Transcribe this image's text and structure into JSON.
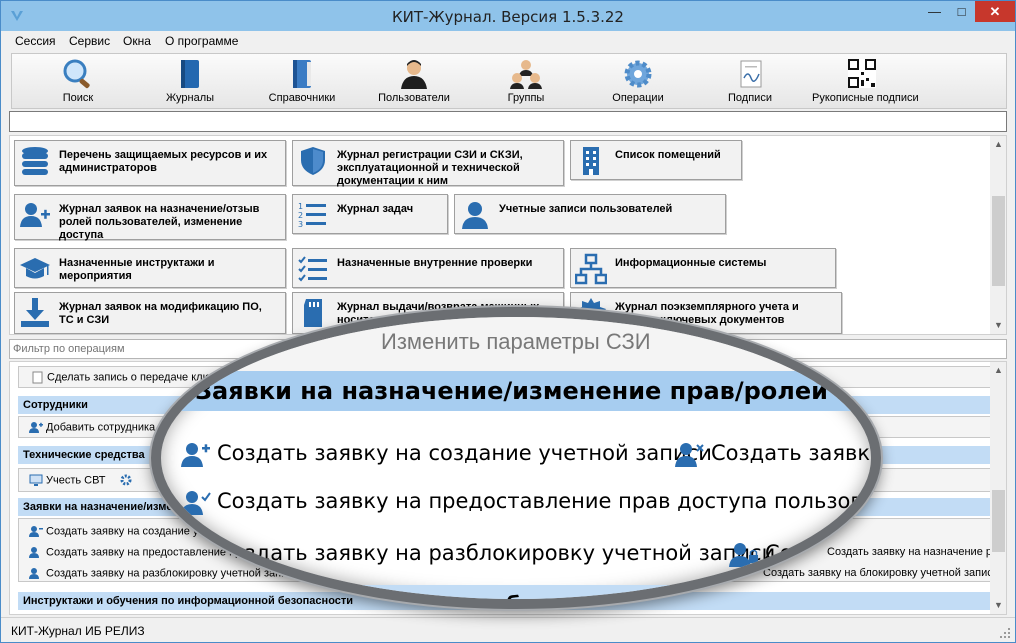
{
  "window": {
    "title": "КИТ-Журнал. Версия 1.5.3.22",
    "buttons": {
      "minimize": "—",
      "maximize": "□",
      "close": "✕"
    }
  },
  "menu": [
    "Сессия",
    "Сервис",
    "Окна",
    "О программе"
  ],
  "toolbar": [
    {
      "label": "Поиск",
      "icon": "magnifier-icon"
    },
    {
      "label": "Журналы",
      "icon": "book-icon"
    },
    {
      "label": "Справочники",
      "icon": "reference-book-icon"
    },
    {
      "label": "Пользователи",
      "icon": "user-icon"
    },
    {
      "label": "Группы",
      "icon": "group-icon"
    },
    {
      "label": "Операции",
      "icon": "gear-icon"
    },
    {
      "label": "Подписи",
      "icon": "signature-icon"
    },
    {
      "label": "Рукописные подписи",
      "icon": "qr-code-icon"
    }
  ],
  "search": {
    "value": ""
  },
  "tiles": [
    {
      "label": "Перечень защищаемых ресурсов и их администраторов",
      "icon": "database-icon"
    },
    {
      "label": "Журнал регистрации СЗИ и СКЗИ, эксплуатационной и технической документации к ним",
      "icon": "shield-icon"
    },
    {
      "label": "Список помещений",
      "icon": "building-icon"
    },
    {
      "label": "Журнал заявок на назначение/отзыв ролей пользователей, изменение доступа",
      "icon": "user-add-icon"
    },
    {
      "label": "Журнал задач",
      "icon": "numbered-list-icon"
    },
    {
      "label": "Учетные записи пользователей",
      "icon": "user-circle-icon"
    },
    {
      "label": "Назначенные инструктажи и мероприятия",
      "icon": "graduation-cap-icon"
    },
    {
      "label": "Назначенные внутренние проверки",
      "icon": "checklist-icon"
    },
    {
      "label": "Информационные системы",
      "icon": "network-icon"
    },
    {
      "label": "Журнал заявок на модификацию ПО, ТС и СЗИ",
      "icon": "download-icon"
    },
    {
      "label": "Журнал выдачи/возврата машинных носителей информации",
      "icon": "sd-card-icon"
    },
    {
      "label": "Журнал поэкземплярного учета и выдачи ключевых документов (носителей)",
      "icon": "seal-icon"
    }
  ],
  "filter": {
    "placeholder": "Фильтр по операциям"
  },
  "operations": {
    "first_op": "Сделать запись о передаче ключей",
    "groups": [
      {
        "title": "Сотрудники",
        "ops": [
          "Добавить сотрудника"
        ]
      },
      {
        "title": "Технические средства",
        "ops": [
          "Учесть СВТ"
        ]
      },
      {
        "title": "Заявки на назначение/изменение прав/ролей пользователя",
        "ops": [
          "Создать заявку на создание учетной записи",
          "Создать заявку на предоставление прав доступа пользователю",
          "Создать заявку на разблокировку учетной записи",
          "Создать заявку на назначение роли пользователя",
          "Создать заявку на блокировку учетной записи"
        ]
      },
      {
        "title": "Инструктажи и обучения по информационной безопасности",
        "ops": []
      }
    ]
  },
  "magnifier": {
    "bg_text": "Изменить параметры СЗИ",
    "header": "Заявки на назначение/изменение прав/ролей пользователя",
    "row1_a": "Создать заявку на создание учетной записи",
    "row1_b": "Создать заявку",
    "row2": "Создать заявку на предоставление прав доступа пользователю",
    "row3_a": "Создать заявку на разблокировку учетной записи",
    "row3_b": "Созда",
    "footer": "обучения по информационной б"
  },
  "status": "КИТ-Журнал ИБ РЕЛИЗ",
  "colors": {
    "accent": "#8fc3ea",
    "group_header": "#c2dcf5",
    "icon_blue": "#2a6db0"
  }
}
